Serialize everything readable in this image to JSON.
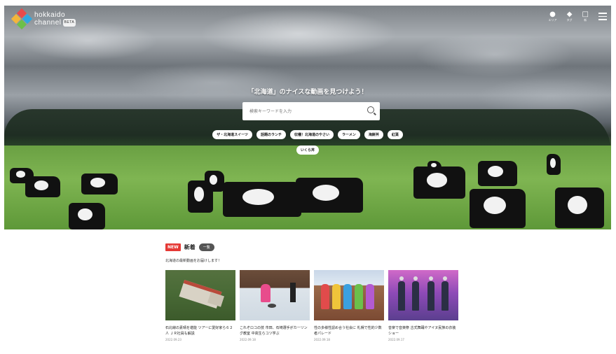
{
  "brand": {
    "line1": "hokkaido",
    "line2": "channel",
    "badge": "BETA"
  },
  "topbar": {
    "items": [
      {
        "label": "エリア",
        "icon": "pin-icon"
      },
      {
        "label": "タグ",
        "icon": "tag-icon"
      },
      {
        "label": "新",
        "icon": "square-icon"
      }
    ]
  },
  "hero": {
    "headline": "「北海道」のナイスな動画を見つけよう！",
    "search_placeholder": "検索キーワードを入力",
    "tags": [
      "ザ・北海道スイーツ",
      "話題のランチ",
      "収穫！北海道のやさい",
      "ラーメン",
      "海鮮丼",
      "紅葉"
    ],
    "tags_row2": [
      "いくら丼"
    ]
  },
  "section": {
    "badge": "NEW",
    "title": "新着",
    "more_label": "一覧",
    "description": "北海道の最新動画をお届けします！",
    "cards": [
      {
        "title": "石北線の素晴を堪能 ツアーに愛好家ら６２人 ＪＲ社員も解説",
        "date": "2022.09.23"
      },
      {
        "title": "これぞロコの技 市田、石崎選手がカーリング教室 中高生らコツ学ぶ",
        "date": "2022.09.18"
      },
      {
        "title": "性の多様性認め合う社会に 札幌で性的少数者パレード",
        "date": "2022.09.18"
      },
      {
        "title": "音楽で音楽祭 古式舞踊やアイヌ民族の衣装ショー",
        "date": "2022.09.17"
      }
    ]
  }
}
